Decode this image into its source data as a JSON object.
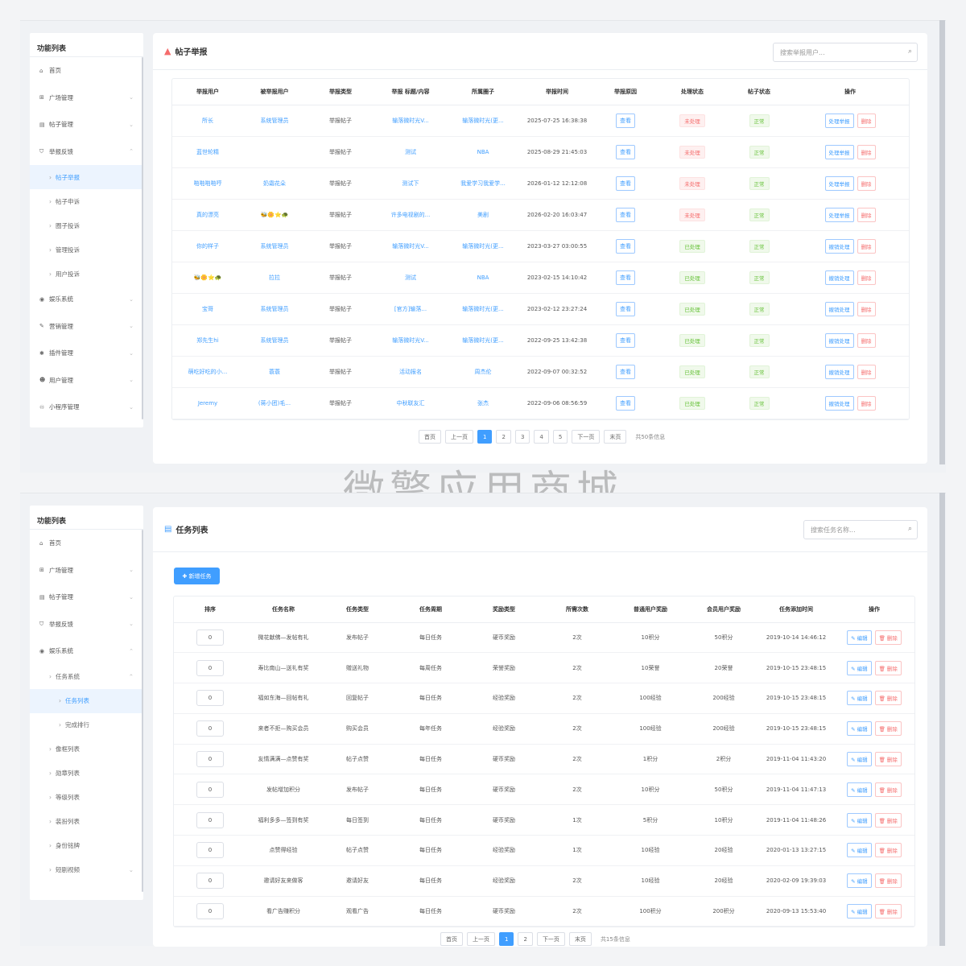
{
  "sidebar_title": "功能列表",
  "panel1": {
    "menu": [
      {
        "label": "首页",
        "icon": "home-icon",
        "chev": ""
      },
      {
        "label": "广场管理",
        "icon": "plaza-icon",
        "chev": "⌄"
      },
      {
        "label": "帖子管理",
        "icon": "post-icon",
        "chev": "⌄"
      },
      {
        "label": "举报反馈",
        "icon": "shield-icon",
        "chev": "⌃"
      }
    ],
    "submenu": [
      {
        "label": "帖子举报",
        "active": true
      },
      {
        "label": "帖子申诉",
        "active": false
      },
      {
        "label": "圈子投诉",
        "active": false
      },
      {
        "label": "管理投诉",
        "active": false
      },
      {
        "label": "用户投诉",
        "active": false
      }
    ],
    "menu_after": [
      {
        "label": "娱乐系统",
        "icon": "entertainment-icon"
      },
      {
        "label": "营销管理",
        "icon": "marketing-icon"
      },
      {
        "label": "插件管理",
        "icon": "plugin-icon"
      },
      {
        "label": "用户管理",
        "icon": "users-icon"
      },
      {
        "label": "小程序管理",
        "icon": "miniapp-icon"
      }
    ],
    "title": "帖子举报",
    "search_placeholder": "搜索举报用户...",
    "headers": [
      "举报用户",
      "被举报用户",
      "举报类型",
      "举报 标题/内容",
      "所属圈子",
      "举报时间",
      "举报原因",
      "处理状态",
      "帖子状态",
      "操作"
    ],
    "rows": [
      {
        "u": "所长",
        "v": "系统管理员",
        "type": "举报帖子",
        "title": "输落微时光V...",
        "circle": "输落微时光(更...",
        "time": "2025-07-25 16:38:38",
        "view": "查看",
        "status": "未处理",
        "sc": "red",
        "post": "正常",
        "op": "处理举报",
        "del": "删除"
      },
      {
        "u": "蓝世轮精",
        "v": "",
        "type": "举报帖子",
        "title": "测试",
        "circle": "NBA",
        "time": "2025-08-29 21:45:03",
        "view": "查看",
        "status": "未处理",
        "sc": "red",
        "post": "正常",
        "op": "处理举报",
        "del": "删除"
      },
      {
        "u": "啪啪啪啪哼",
        "v": "奶霜花朵",
        "type": "举报帖子",
        "title": "测试下",
        "circle": "我爱学习我爱学...",
        "time": "2026-01-12 12:12:08",
        "view": "查看",
        "status": "未处理",
        "sc": "red",
        "post": "正常",
        "op": "处理举报",
        "del": "删除"
      },
      {
        "u": "真的漂亮",
        "v": "🐝🌼⭐🐢",
        "type": "举报帖子",
        "title": "许多电视剧的...",
        "circle": "美剧",
        "time": "2026-02-20 16:03:47",
        "view": "查看",
        "status": "未处理",
        "sc": "red",
        "post": "正常",
        "op": "处理举报",
        "del": "删除"
      },
      {
        "u": "你的样子",
        "v": "系统管理员",
        "type": "举报帖子",
        "title": "输落微时光V...",
        "circle": "输落微时光(更...",
        "time": "2023-03-27 03:00:55",
        "view": "查看",
        "status": "已处理",
        "sc": "green",
        "post": "正常",
        "op": "撤销处理",
        "del": "删除"
      },
      {
        "u": "🐝🌼⭐🐢",
        "v": "拉拉",
        "type": "举报帖子",
        "title": "测试",
        "circle": "NBA",
        "time": "2023-02-15 14:10:42",
        "view": "查看",
        "status": "已处理",
        "sc": "green",
        "post": "正常",
        "op": "撤销处理",
        "del": "删除"
      },
      {
        "u": "宝哥",
        "v": "系统管理员",
        "type": "举报帖子",
        "title": "[官方]输落...",
        "circle": "输落微时光(更...",
        "time": "2023-02-12 23:27:24",
        "view": "查看",
        "status": "已处理",
        "sc": "green",
        "post": "正常",
        "op": "撤销处理",
        "del": "删除"
      },
      {
        "u": "郑先生hi",
        "v": "系统管理员",
        "type": "举报帖子",
        "title": "输落微时光V...",
        "circle": "输落微时光(更...",
        "time": "2022-09-25 13:42:38",
        "view": "查看",
        "status": "已处理",
        "sc": "green",
        "post": "正常",
        "op": "撤销处理",
        "del": "删除"
      },
      {
        "u": "萌吃好吃的小...",
        "v": "蓑蓑",
        "type": "举报帖子",
        "title": "活动报名",
        "circle": "周杰伦",
        "time": "2022-09-07 00:32:52",
        "view": "查看",
        "status": "已处理",
        "sc": "green",
        "post": "正常",
        "op": "撤销处理",
        "del": "删除"
      },
      {
        "u": "Jeremy",
        "v": "(蒋小团)毛...",
        "type": "举报帖子",
        "title": "中秋联友汇",
        "circle": "张杰",
        "time": "2022-09-06 08:56:59",
        "view": "查看",
        "status": "已处理",
        "sc": "green",
        "post": "正常",
        "op": "撤销处理",
        "del": "删除"
      }
    ],
    "pager": {
      "first": "首页",
      "prev": "上一页",
      "pages": [
        "1",
        "2",
        "3",
        "4",
        "5"
      ],
      "current": "1",
      "next": "下一页",
      "last": "末页",
      "info": "共50条信息"
    }
  },
  "watermark": "微擎应用商城",
  "panel2": {
    "menu": [
      {
        "label": "首页",
        "icon": "home-icon",
        "chev": ""
      },
      {
        "label": "广场管理",
        "icon": "plaza-icon",
        "chev": "⌄"
      },
      {
        "label": "帖子管理",
        "icon": "post-icon",
        "chev": "⌄"
      },
      {
        "label": "举报反馈",
        "icon": "shield-icon",
        "chev": "⌄"
      },
      {
        "label": "娱乐系统",
        "icon": "entertainment-icon",
        "chev": "⌃"
      }
    ],
    "submenu": [
      {
        "label": "任务系统",
        "deep": false,
        "active": false,
        "chev": "⌃"
      },
      {
        "label": "任务列表",
        "deep": true,
        "active": true,
        "chev": ""
      },
      {
        "label": "完成排行",
        "deep": true,
        "active": false,
        "chev": ""
      },
      {
        "label": "像框列表",
        "deep": false,
        "active": false,
        "chev": ""
      },
      {
        "label": "勋章列表",
        "deep": false,
        "active": false,
        "chev": ""
      },
      {
        "label": "等级列表",
        "deep": false,
        "active": false,
        "chev": ""
      },
      {
        "label": "装扮列表",
        "deep": false,
        "active": false,
        "chev": ""
      },
      {
        "label": "身份铭牌",
        "deep": false,
        "active": false,
        "chev": ""
      },
      {
        "label": "短剧视频",
        "deep": false,
        "active": false,
        "chev": "⌄"
      }
    ],
    "title": "任务列表",
    "search_placeholder": "搜索任务名称...",
    "add_button": "✚ 新增任务",
    "headers": [
      "排序",
      "任务名称",
      "任务类型",
      "任务周期",
      "奖励类型",
      "所需次数",
      "普通用户奖励",
      "会员用户奖励",
      "任务添加时间",
      "操作"
    ],
    "rows": [
      {
        "sort": "0",
        "name": "微花献佛—发帖有礼",
        "type": "发布帖子",
        "cycle": "每日任务",
        "reward": "硬币奖励",
        "times": "2次",
        "normal": "10积分",
        "vip": "50积分",
        "time": "2019-10-14 14:46:12"
      },
      {
        "sort": "0",
        "name": "寿比南山—送礼有奖",
        "type": "赠送礼物",
        "cycle": "每周任务",
        "reward": "荣誉奖励",
        "times": "2次",
        "normal": "10荣誉",
        "vip": "20荣誉",
        "time": "2019-10-15 23:48:15"
      },
      {
        "sort": "0",
        "name": "福如东海—回帖有礼",
        "type": "回复帖子",
        "cycle": "每日任务",
        "reward": "经验奖励",
        "times": "2次",
        "normal": "100经验",
        "vip": "200经验",
        "time": "2019-10-15 23:48:15"
      },
      {
        "sort": "0",
        "name": "来者不拒—购买会员",
        "type": "购买会员",
        "cycle": "每年任务",
        "reward": "经验奖励",
        "times": "2次",
        "normal": "100经验",
        "vip": "200经验",
        "time": "2019-10-15 23:48:15"
      },
      {
        "sort": "0",
        "name": "友情满满—点赞有奖",
        "type": "帖子点赞",
        "cycle": "每日任务",
        "reward": "硬币奖励",
        "times": "2次",
        "normal": "1积分",
        "vip": "2积分",
        "time": "2019-11-04 11:43:20"
      },
      {
        "sort": "0",
        "name": "发帖增加积分",
        "type": "发布帖子",
        "cycle": "每日任务",
        "reward": "硬币奖励",
        "times": "2次",
        "normal": "10积分",
        "vip": "50积分",
        "time": "2019-11-04 11:47:13"
      },
      {
        "sort": "0",
        "name": "福利多多—签到有奖",
        "type": "每日签到",
        "cycle": "每日任务",
        "reward": "硬币奖励",
        "times": "1次",
        "normal": "5积分",
        "vip": "10积分",
        "time": "2019-11-04 11:48:26"
      },
      {
        "sort": "0",
        "name": "点赞得经验",
        "type": "帖子点赞",
        "cycle": "每日任务",
        "reward": "经验奖励",
        "times": "1次",
        "normal": "10经验",
        "vip": "20经验",
        "time": "2020-01-13 13:27:15"
      },
      {
        "sort": "0",
        "name": "邀请好友来做客",
        "type": "邀请好友",
        "cycle": "每日任务",
        "reward": "经验奖励",
        "times": "2次",
        "normal": "10经验",
        "vip": "20经验",
        "time": "2020-02-09 19:39:03"
      },
      {
        "sort": "0",
        "name": "看广告赚积分",
        "type": "观看广告",
        "cycle": "每日任务",
        "reward": "硬币奖励",
        "times": "2次",
        "normal": "100积分",
        "vip": "200积分",
        "time": "2020-09-13 15:53:40"
      }
    ],
    "edit_label": "✎ 编辑",
    "delete_label": "🗑 删除",
    "pager": {
      "first": "首页",
      "prev": "上一页",
      "pages": [
        "1",
        "2"
      ],
      "current": "1",
      "next": "下一页",
      "last": "末页",
      "info": "共15条信息"
    }
  }
}
